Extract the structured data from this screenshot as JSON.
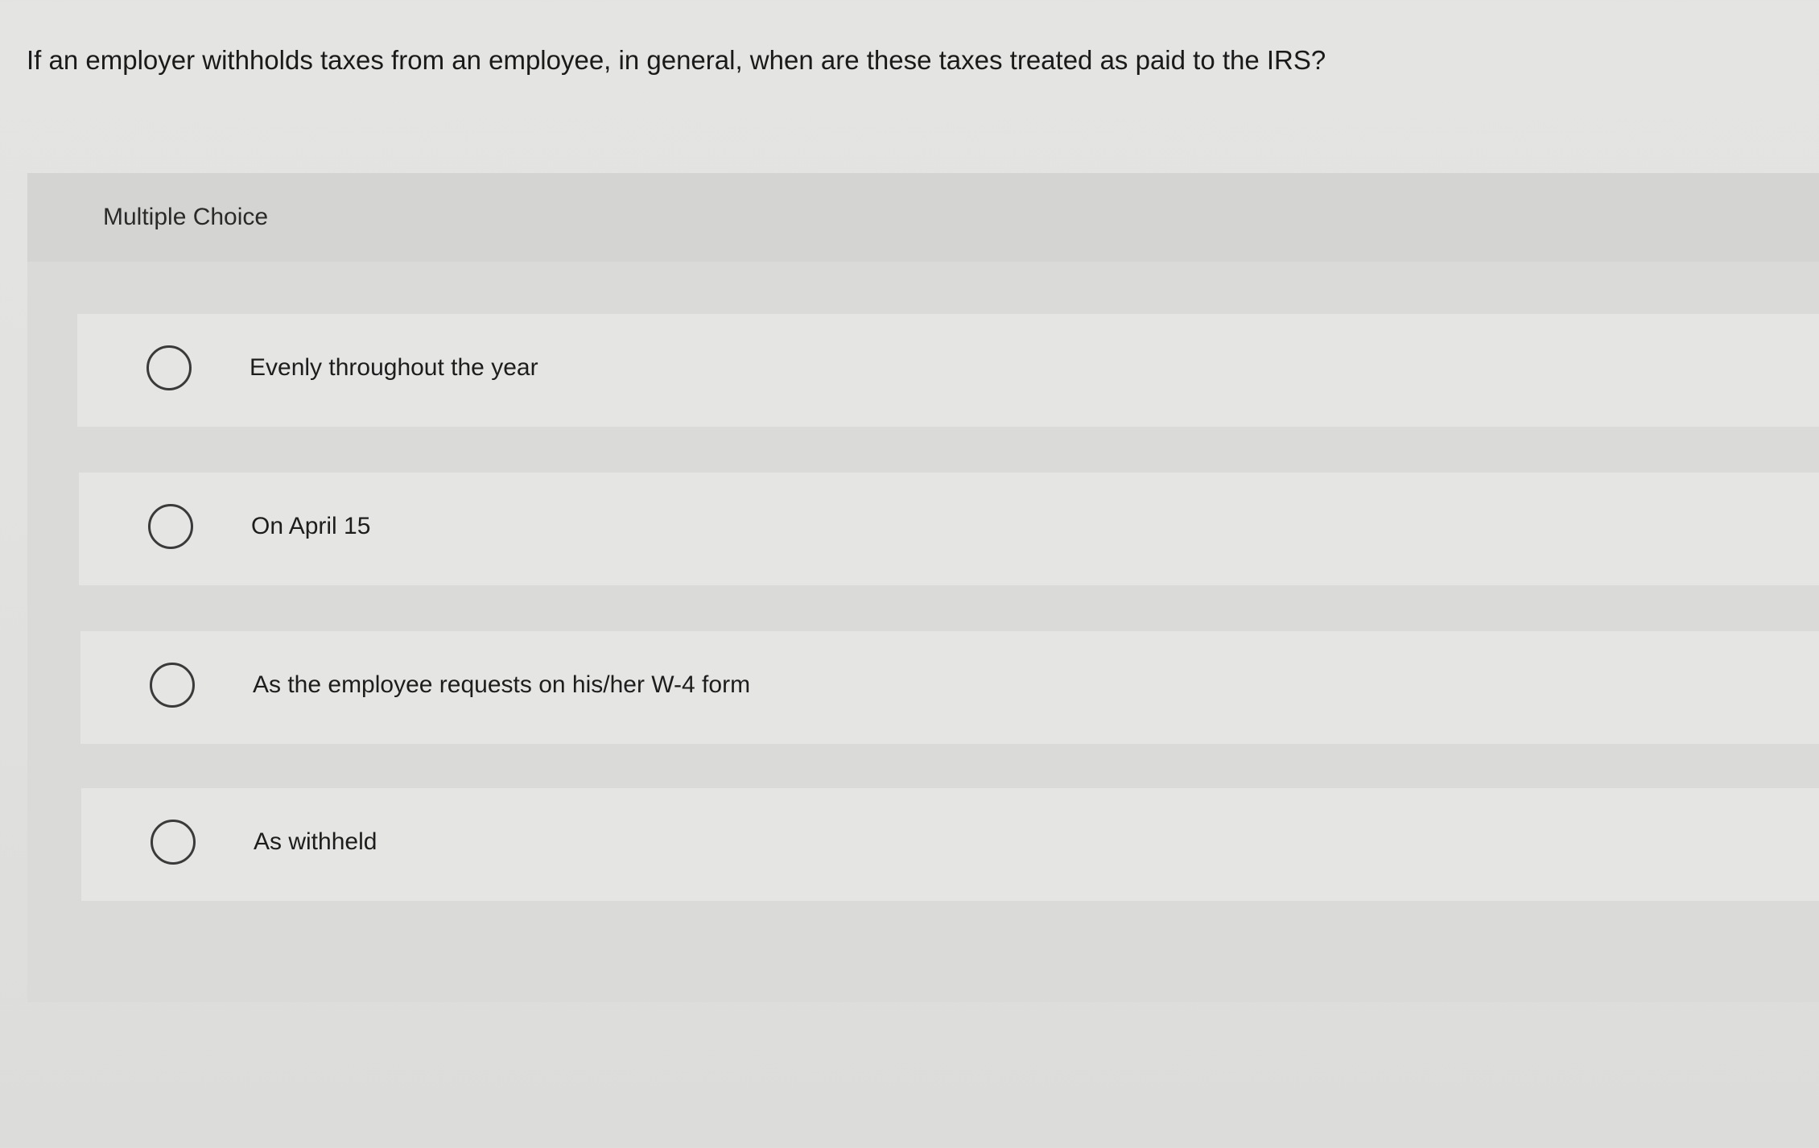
{
  "question": {
    "text": "If an employer withholds taxes from an employee, in general, when are these taxes treated as paid to the IRS?"
  },
  "multiple_choice": {
    "label": "Multiple Choice",
    "options": [
      {
        "label": "Evenly throughout the year",
        "selected": false
      },
      {
        "label": "On April 15",
        "selected": false
      },
      {
        "label": "As the employee requests on his/her W-4 form",
        "selected": false
      },
      {
        "label": "As withheld",
        "selected": false
      }
    ]
  }
}
